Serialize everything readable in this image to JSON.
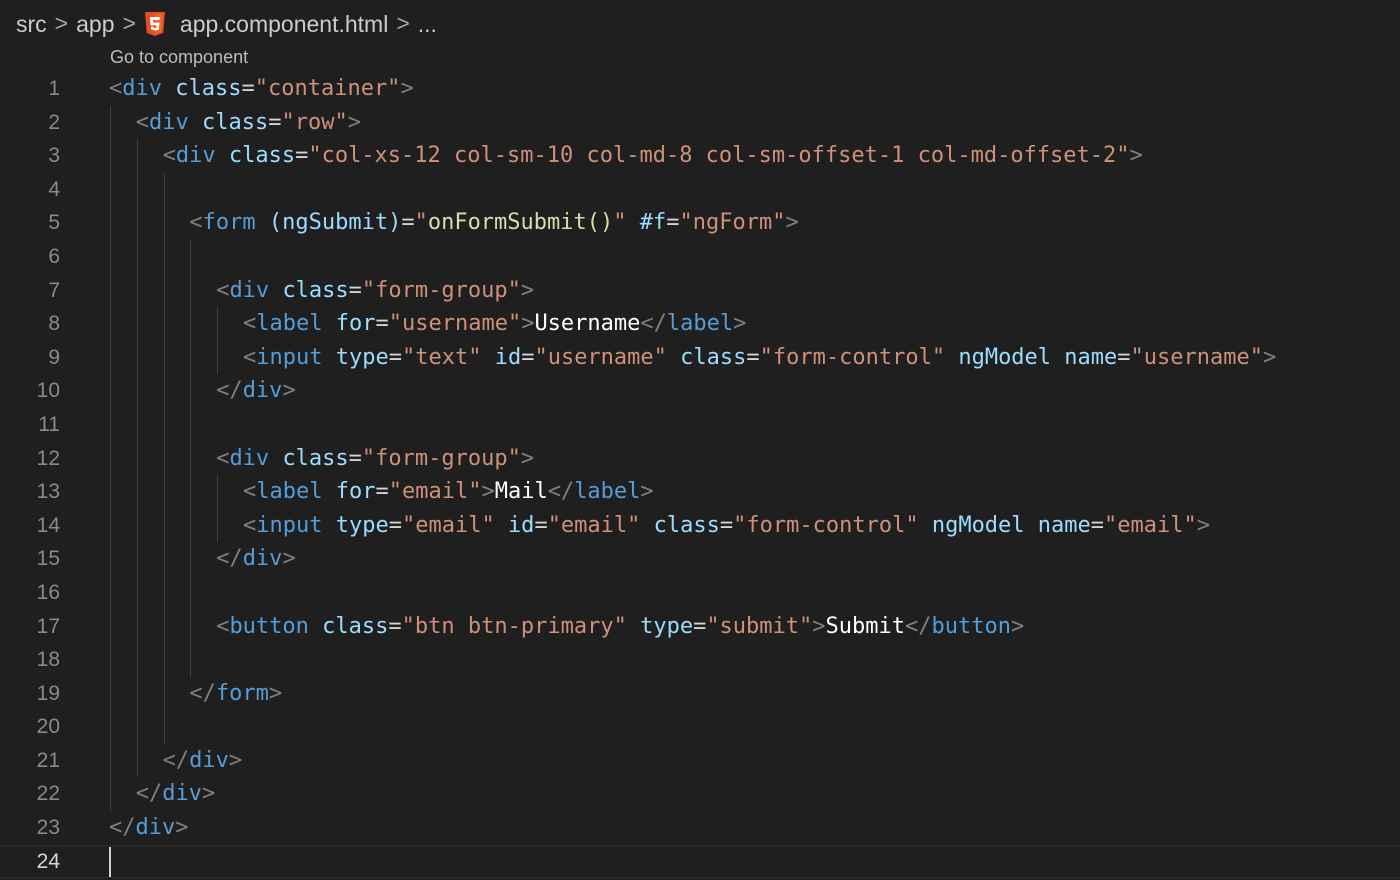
{
  "breadcrumb": {
    "items": [
      "src",
      "app",
      "app.component.html",
      "..."
    ],
    "separator": ">",
    "file_icon": "html5-icon"
  },
  "codelens": "Go to component",
  "cursor_line": 24,
  "colors": {
    "background": "#1f1f1f",
    "tag": "#569cd6",
    "attribute": "#9cdcfe",
    "string": "#ce9178",
    "function": "#dcdcaa",
    "bracket": "#808080",
    "text": "#ffffff",
    "html5_icon": "#e44d26"
  },
  "lines": [
    {
      "n": "1",
      "indent": 0,
      "tokens": [
        [
          "bracket",
          "<"
        ],
        [
          "tag",
          "div"
        ],
        [
          "eq",
          " "
        ],
        [
          "attr",
          "class"
        ],
        [
          "eq",
          "="
        ],
        [
          "str",
          "\"container\""
        ],
        [
          "bracket",
          ">"
        ]
      ]
    },
    {
      "n": "2",
      "indent": 1,
      "tokens": [
        [
          "bracket",
          "<"
        ],
        [
          "tag",
          "div"
        ],
        [
          "eq",
          " "
        ],
        [
          "attr",
          "class"
        ],
        [
          "eq",
          "="
        ],
        [
          "str",
          "\"row\""
        ],
        [
          "bracket",
          ">"
        ]
      ]
    },
    {
      "n": "3",
      "indent": 2,
      "tokens": [
        [
          "bracket",
          "<"
        ],
        [
          "tag",
          "div"
        ],
        [
          "eq",
          " "
        ],
        [
          "attr",
          "class"
        ],
        [
          "eq",
          "="
        ],
        [
          "str",
          "\"col-xs-12 col-sm-10 col-md-8 col-sm-offset-1 col-md-offset-2\""
        ],
        [
          "bracket",
          ">"
        ]
      ]
    },
    {
      "n": "4",
      "indent": 3,
      "tokens": []
    },
    {
      "n": "5",
      "indent": 3,
      "tokens": [
        [
          "bracket",
          "<"
        ],
        [
          "tag",
          "form"
        ],
        [
          "eq",
          " "
        ],
        [
          "attr",
          "(ngSubmit)"
        ],
        [
          "eq",
          "="
        ],
        [
          "str",
          "\""
        ],
        [
          "fn",
          "onFormSubmit()"
        ],
        [
          "str",
          "\""
        ],
        [
          "eq",
          " "
        ],
        [
          "attr",
          "#f"
        ],
        [
          "eq",
          "="
        ],
        [
          "str",
          "\"ngForm\""
        ],
        [
          "bracket",
          ">"
        ]
      ]
    },
    {
      "n": "6",
      "indent": 4,
      "tokens": []
    },
    {
      "n": "7",
      "indent": 4,
      "tokens": [
        [
          "bracket",
          "<"
        ],
        [
          "tag",
          "div"
        ],
        [
          "eq",
          " "
        ],
        [
          "attr",
          "class"
        ],
        [
          "eq",
          "="
        ],
        [
          "str",
          "\"form-group\""
        ],
        [
          "bracket",
          ">"
        ]
      ]
    },
    {
      "n": "8",
      "indent": 5,
      "tokens": [
        [
          "bracket",
          "<"
        ],
        [
          "tag",
          "label"
        ],
        [
          "eq",
          " "
        ],
        [
          "attr",
          "for"
        ],
        [
          "eq",
          "="
        ],
        [
          "str",
          "\"username\""
        ],
        [
          "bracket",
          ">"
        ],
        [
          "text",
          "Username"
        ],
        [
          "bracket",
          "</"
        ],
        [
          "tag",
          "label"
        ],
        [
          "bracket",
          ">"
        ]
      ]
    },
    {
      "n": "9",
      "indent": 5,
      "tokens": [
        [
          "bracket",
          "<"
        ],
        [
          "tag",
          "input"
        ],
        [
          "eq",
          " "
        ],
        [
          "attr",
          "type"
        ],
        [
          "eq",
          "="
        ],
        [
          "str",
          "\"text\""
        ],
        [
          "eq",
          " "
        ],
        [
          "attr",
          "id"
        ],
        [
          "eq",
          "="
        ],
        [
          "str",
          "\"username\""
        ],
        [
          "eq",
          " "
        ],
        [
          "attr",
          "class"
        ],
        [
          "eq",
          "="
        ],
        [
          "str",
          "\"form-control\""
        ],
        [
          "eq",
          " "
        ],
        [
          "attr",
          "ngModel"
        ],
        [
          "eq",
          " "
        ],
        [
          "attr",
          "name"
        ],
        [
          "eq",
          "="
        ],
        [
          "str",
          "\"username\""
        ],
        [
          "bracket",
          ">"
        ]
      ]
    },
    {
      "n": "10",
      "indent": 4,
      "tokens": [
        [
          "bracket",
          "</"
        ],
        [
          "tag",
          "div"
        ],
        [
          "bracket",
          ">"
        ]
      ]
    },
    {
      "n": "11",
      "indent": 4,
      "tokens": []
    },
    {
      "n": "12",
      "indent": 4,
      "tokens": [
        [
          "bracket",
          "<"
        ],
        [
          "tag",
          "div"
        ],
        [
          "eq",
          " "
        ],
        [
          "attr",
          "class"
        ],
        [
          "eq",
          "="
        ],
        [
          "str",
          "\"form-group\""
        ],
        [
          "bracket",
          ">"
        ]
      ]
    },
    {
      "n": "13",
      "indent": 5,
      "tokens": [
        [
          "bracket",
          "<"
        ],
        [
          "tag",
          "label"
        ],
        [
          "eq",
          " "
        ],
        [
          "attr",
          "for"
        ],
        [
          "eq",
          "="
        ],
        [
          "str",
          "\"email\""
        ],
        [
          "bracket",
          ">"
        ],
        [
          "text",
          "Mail"
        ],
        [
          "bracket",
          "</"
        ],
        [
          "tag",
          "label"
        ],
        [
          "bracket",
          ">"
        ]
      ]
    },
    {
      "n": "14",
      "indent": 5,
      "tokens": [
        [
          "bracket",
          "<"
        ],
        [
          "tag",
          "input"
        ],
        [
          "eq",
          " "
        ],
        [
          "attr",
          "type"
        ],
        [
          "eq",
          "="
        ],
        [
          "str",
          "\"email\""
        ],
        [
          "eq",
          " "
        ],
        [
          "attr",
          "id"
        ],
        [
          "eq",
          "="
        ],
        [
          "str",
          "\"email\""
        ],
        [
          "eq",
          " "
        ],
        [
          "attr",
          "class"
        ],
        [
          "eq",
          "="
        ],
        [
          "str",
          "\"form-control\""
        ],
        [
          "eq",
          " "
        ],
        [
          "attr",
          "ngModel"
        ],
        [
          "eq",
          " "
        ],
        [
          "attr",
          "name"
        ],
        [
          "eq",
          "="
        ],
        [
          "str",
          "\"email\""
        ],
        [
          "bracket",
          ">"
        ]
      ]
    },
    {
      "n": "15",
      "indent": 4,
      "tokens": [
        [
          "bracket",
          "</"
        ],
        [
          "tag",
          "div"
        ],
        [
          "bracket",
          ">"
        ]
      ]
    },
    {
      "n": "16",
      "indent": 4,
      "tokens": []
    },
    {
      "n": "17",
      "indent": 4,
      "tokens": [
        [
          "bracket",
          "<"
        ],
        [
          "tag",
          "button"
        ],
        [
          "eq",
          " "
        ],
        [
          "attr",
          "class"
        ],
        [
          "eq",
          "="
        ],
        [
          "str",
          "\"btn btn-primary\""
        ],
        [
          "eq",
          " "
        ],
        [
          "attr",
          "type"
        ],
        [
          "eq",
          "="
        ],
        [
          "str",
          "\"submit\""
        ],
        [
          "bracket",
          ">"
        ],
        [
          "text",
          "Submit"
        ],
        [
          "bracket",
          "</"
        ],
        [
          "tag",
          "button"
        ],
        [
          "bracket",
          ">"
        ]
      ]
    },
    {
      "n": "18",
      "indent": 4,
      "tokens": []
    },
    {
      "n": "19",
      "indent": 3,
      "tokens": [
        [
          "bracket",
          "</"
        ],
        [
          "tag",
          "form"
        ],
        [
          "bracket",
          ">"
        ]
      ]
    },
    {
      "n": "20",
      "indent": 3,
      "tokens": []
    },
    {
      "n": "21",
      "indent": 2,
      "tokens": [
        [
          "bracket",
          "</"
        ],
        [
          "tag",
          "div"
        ],
        [
          "bracket",
          ">"
        ]
      ]
    },
    {
      "n": "22",
      "indent": 1,
      "tokens": [
        [
          "bracket",
          "</"
        ],
        [
          "tag",
          "div"
        ],
        [
          "bracket",
          ">"
        ]
      ]
    },
    {
      "n": "23",
      "indent": 0,
      "tokens": [
        [
          "bracket",
          "</"
        ],
        [
          "tag",
          "div"
        ],
        [
          "bracket",
          ">"
        ]
      ]
    },
    {
      "n": "24",
      "indent": 0,
      "tokens": []
    }
  ]
}
